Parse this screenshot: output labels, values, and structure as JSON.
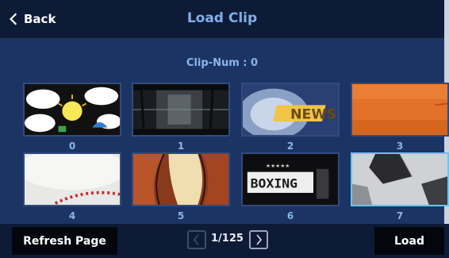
{
  "header": {
    "back_label": "Back",
    "title": "Load Clip"
  },
  "main": {
    "clip_num": "Clip-Num : 0"
  },
  "clips": [
    {
      "label": "0",
      "icon": "weather-sun-clouds-thumbnail",
      "selected": false
    },
    {
      "label": "1",
      "icon": "dark-grunge-texture-thumbnail",
      "selected": false
    },
    {
      "label": "2",
      "icon": "news-globe-thumbnail",
      "selected": false
    },
    {
      "label": "3",
      "icon": "orange-texture-thumbnail",
      "selected": false
    },
    {
      "label": "4",
      "icon": "baseball-thumbnail",
      "selected": false
    },
    {
      "label": "5",
      "icon": "basketball-thumbnail",
      "selected": false
    },
    {
      "label": "6",
      "icon": "boxing-sign-thumbnail",
      "selected": false
    },
    {
      "label": "7",
      "icon": "soccer-ball-thumbnail",
      "selected": true
    }
  ],
  "footer": {
    "refresh_label": "Refresh Page",
    "page_indicator": "1/125",
    "load_label": "Load"
  },
  "colors": {
    "background": "#1c3464",
    "bars": "#0e1b36",
    "title": "#7fb0ea",
    "selection": "#63c7f0"
  }
}
